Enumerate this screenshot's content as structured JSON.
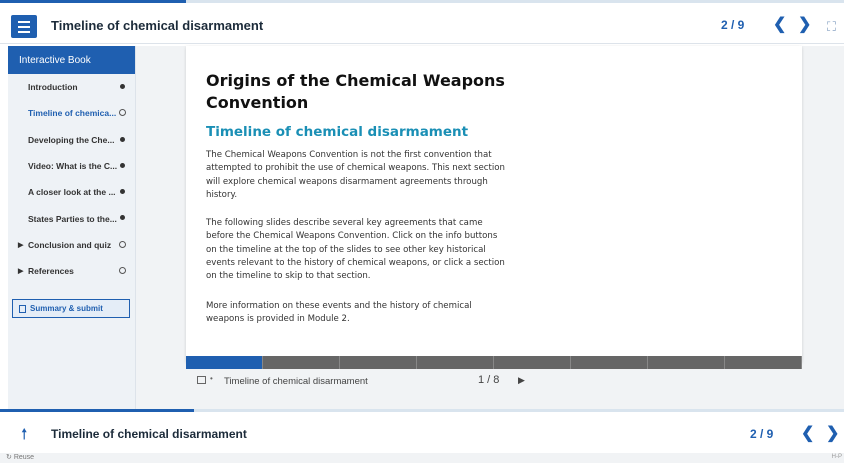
{
  "header": {
    "title": "Timeline of chemical disarmament",
    "page_indicator": "2 / 9",
    "prev_icon": "chevron-left-icon",
    "next_icon": "chevron-right-icon",
    "fullscreen_icon": "fullscreen-icon",
    "progress": 0.22
  },
  "sidebar": {
    "title": "Interactive Book",
    "items": [
      {
        "label": "Introduction",
        "status": "done"
      },
      {
        "label": "Timeline of chemica...",
        "status": "open",
        "active": true
      },
      {
        "label": "Developing the Che...",
        "status": "done"
      },
      {
        "label": "Video: What is the C...",
        "status": "done"
      },
      {
        "label": "A closer look at the ...",
        "status": "done"
      },
      {
        "label": "States Parties to the...",
        "status": "done"
      },
      {
        "label": "Conclusion and quiz",
        "status": "open",
        "expandable": true
      },
      {
        "label": "References",
        "status": "open",
        "expandable": true
      }
    ],
    "summary_label": "Summary & submit"
  },
  "slide": {
    "heading": "Origins of the Chemical Weapons Convention",
    "subheading": "Timeline of chemical disarmament",
    "paragraphs": [
      "The Chemical Weapons Convention is not the first convention that attempted to prohibit the use of chemical weapons. This next section will explore chemical weapons disarmament agreements through history.",
      "The following slides describe several key agreements that came before the Chemical Weapons Convention. Click on the info buttons on the timeline at the top of the slides to see other key historical events relevant to the history of chemical weapons, or click a section on the timeline to skip to that section.",
      "More information on these events and the history of chemical weapons is provided in Module 2."
    ],
    "segments": 8,
    "active_segment": 0
  },
  "slide_footer": {
    "title": "Timeline of chemical disarmament",
    "count": "1 / 8",
    "next_icon": "play-right-icon"
  },
  "bottom": {
    "title": "Timeline of chemical disarmament",
    "page_indicator": "2 / 9",
    "up_icon": "arrow-up-icon",
    "progress": 0.23
  },
  "footer": {
    "reuse_label": "Reuse",
    "brand": "H-P"
  }
}
